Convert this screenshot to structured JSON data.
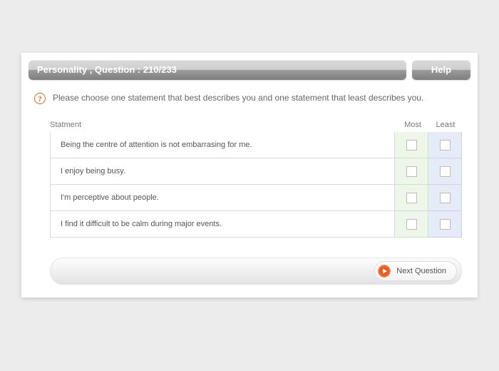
{
  "header": {
    "title": "Personality , Question : 210/233",
    "help_label": "Help"
  },
  "instruction": "Please choose one statement that best describes you and one statement that least describes you.",
  "columns": {
    "statement": "Statment",
    "most": "Most",
    "least": "Least"
  },
  "statements": [
    "Being the centre of attention is not embarrasing for me.",
    "I enjoy being busy.",
    "I'm perceptive about people.",
    "I find it difficult to be calm during major events."
  ],
  "footer": {
    "next_label": "Next Question"
  }
}
